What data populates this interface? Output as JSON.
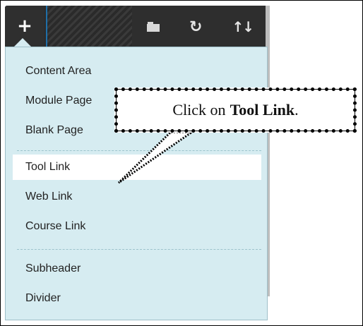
{
  "toolbar": {
    "add_label": "+",
    "icons": [
      "folder-icon",
      "refresh-icon",
      "sort-icon"
    ]
  },
  "menu": {
    "items": [
      {
        "label": "Content Area"
      },
      {
        "label": "Module Page"
      },
      {
        "label": "Blank Page"
      },
      {
        "label": "Tool Link"
      },
      {
        "label": "Web Link"
      },
      {
        "label": "Course Link"
      },
      {
        "label": "Subheader"
      },
      {
        "label": "Divider"
      }
    ],
    "active_item": "Tool Link"
  },
  "callout": {
    "prefix": "Click on",
    "highlight": "Tool Link",
    "suffix": "."
  },
  "colors": {
    "toolbar_bg": "#2b2b2b",
    "menu_bg": "#d6ecf1",
    "active_bg": "#ffffff",
    "accent": "#1f6fa8"
  }
}
